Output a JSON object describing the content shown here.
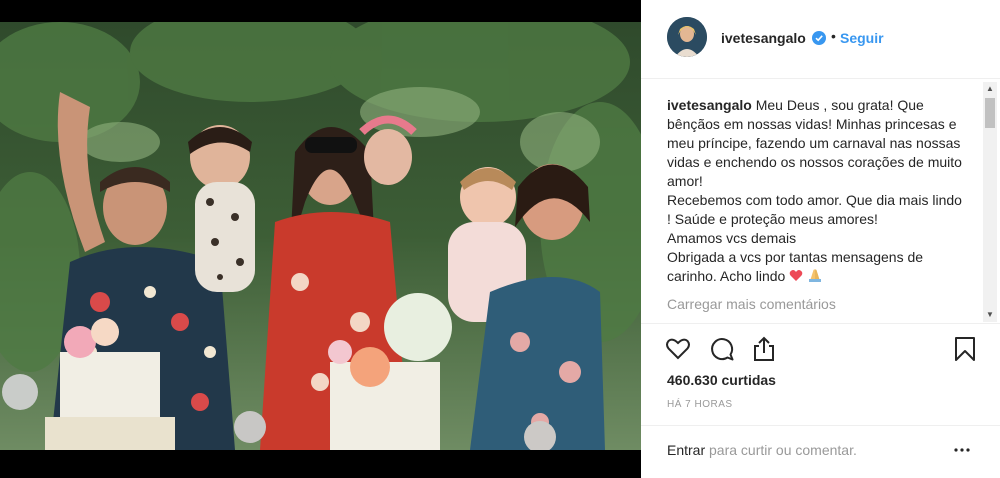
{
  "post": {
    "username": "ivetesangalo",
    "separator": "•",
    "follow_label": "Seguir",
    "caption_user": "ivetesangalo",
    "caption_text": " Meu Deus , sou grata! Que bênçãos em nossas vidas! Minhas princesas e meu príncipe, fazendo um carnaval nas nossas vidas e enchendo os nossos corações de muito amor!\nRecebemos com todo amor. Que dia mais lindo ! Saúde e proteção meus amores!\nAmamos vcs demais\nObrigada a vcs por tantas mensagens de carinho. Acho lindo",
    "caption_emoji": [
      "heart-emoji",
      "praying-hands-emoji"
    ],
    "load_more_label": "Carregar mais comentários",
    "likes": "460.630 curtidas",
    "time": "HÁ 7 HORAS",
    "comment_enter": "Entrar",
    "comment_rest": " para curtir ou comentar."
  },
  "icons": {
    "like": "heart-outline-icon",
    "comment": "comment-icon",
    "share": "share-icon",
    "save": "bookmark-icon",
    "more": "more-dots-icon",
    "verified": "verified-badge-icon"
  },
  "colors": {
    "link_blue": "#3897f0",
    "text": "#262626",
    "muted": "#999999",
    "heart": "#ed4956"
  }
}
